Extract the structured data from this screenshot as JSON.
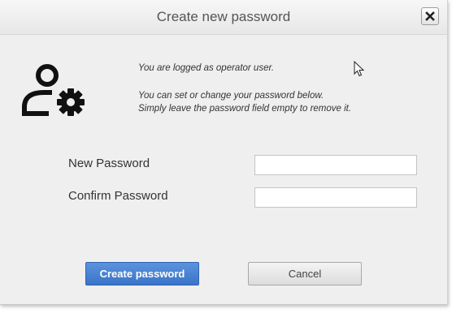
{
  "dialog": {
    "title": "Create new password",
    "close_icon": "close-icon"
  },
  "info": {
    "line1": "You are logged as operator user.",
    "line2": "You can set or change your password below.",
    "line3": "Simply leave the password field empty to remove it."
  },
  "form": {
    "new_password_label": "New Password",
    "new_password_value": "",
    "confirm_password_label": "Confirm Password",
    "confirm_password_value": ""
  },
  "buttons": {
    "create_label": "Create password",
    "cancel_label": "Cancel"
  },
  "icons": {
    "user": "user-settings-icon",
    "cursor": "mouse-pointer-icon"
  },
  "colors": {
    "primary": "#3a74c9",
    "dialog_bg": "#efefef"
  }
}
